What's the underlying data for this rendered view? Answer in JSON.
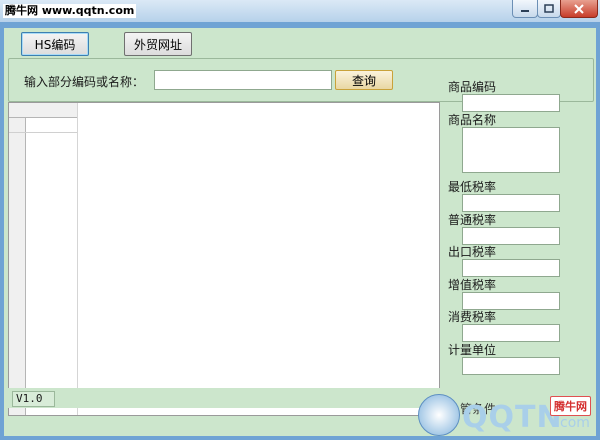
{
  "window": {
    "title": "腾牛网 www.qqtn.com",
    "controls": {
      "minimize": "minimize-icon",
      "maximize": "maximize-icon",
      "close": "close-icon"
    }
  },
  "tabs": {
    "hs_code": "HS编码",
    "trade_links": "外贸网址"
  },
  "search": {
    "label": "输入部分编码或名称：",
    "value": "",
    "button": "查询"
  },
  "details": {
    "code_label": "商品编码",
    "name_label": "商品名称",
    "min_rate_label": "最低税率",
    "general_rate_label": "普通税率",
    "export_rate_label": "出口税率",
    "vat_rate_label": "增值税率",
    "consumption_rate_label": "消费税率",
    "unit_label": "计量单位",
    "supervision_label": "管条件"
  },
  "status": {
    "version": "V1.0"
  },
  "watermark": {
    "brand": "QQTN",
    "suffix": "com",
    "badge": "腾牛网"
  }
}
